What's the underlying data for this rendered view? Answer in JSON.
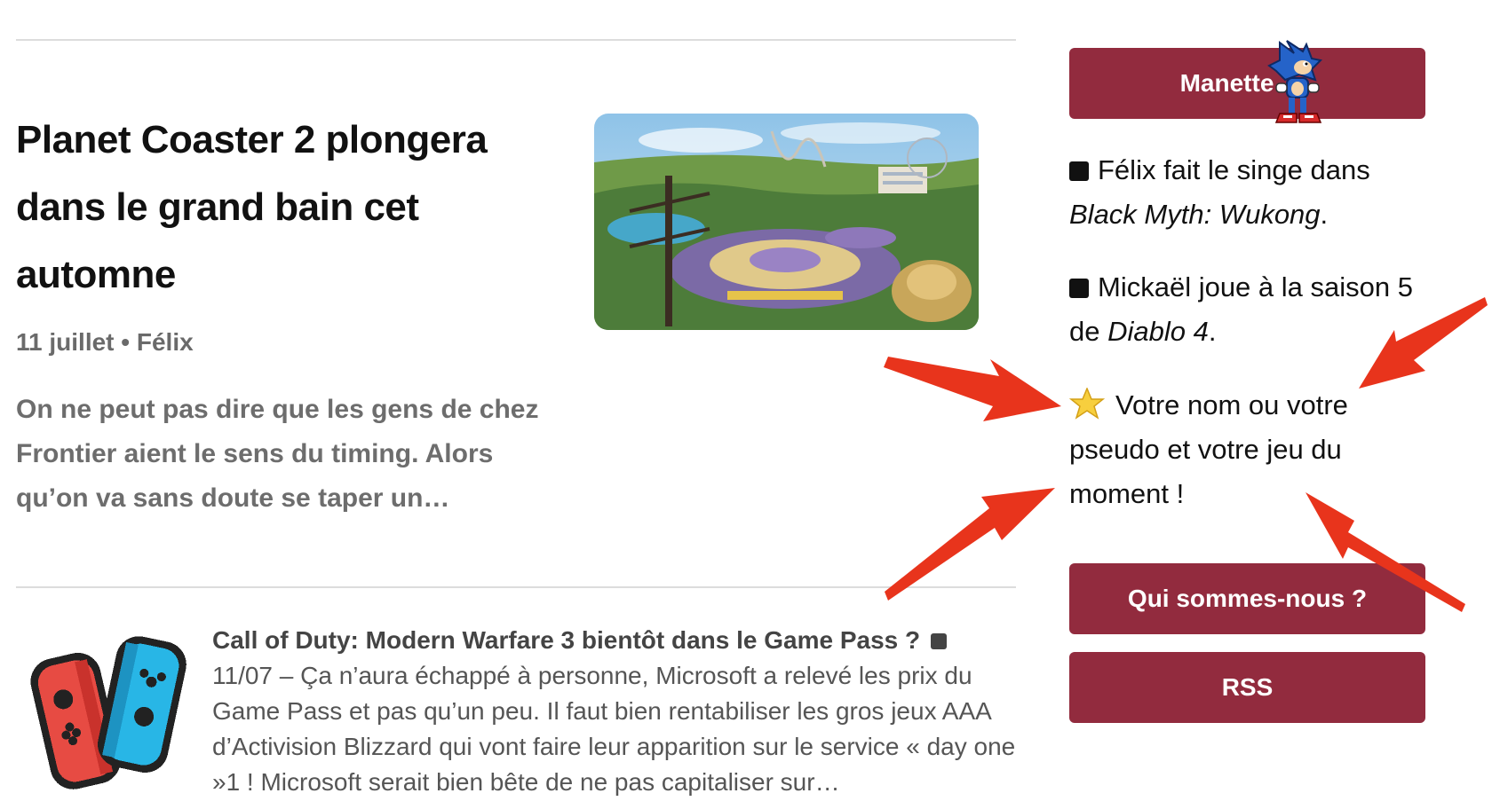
{
  "article": {
    "title": "Planet Coaster 2 plongera dans le grand bain cet automne",
    "meta": "11 juillet • Félix",
    "excerpt": "On ne peut pas dire que les gens de chez Frontier aient le sens du timing. Alors qu’on va sans doute se taper un…"
  },
  "short": {
    "title": "Call of Duty: Modern Warfare 3 bientôt dans le Game Pass ?",
    "body": "11/07 – Ça n’aura échappé à personne, Microsoft a relevé les prix du Game Pass et pas qu’un peu. Il faut bien rentabiliser les gros jeux AAA d’Activision Blizzard qui vont faire leur apparition sur le service « day one »1 ! Microsoft serait bien bête de ne pas capitaliser sur…"
  },
  "sidebar": {
    "manette_label": "Manette",
    "item1_prefix": "Félix fait le singe dans ",
    "item1_game": "Black Myth: Wukong",
    "item1_suffix": ".",
    "item2_prefix": "Mickaël joue à la saison 5 de ",
    "item2_game": "Diablo 4",
    "item2_suffix": ".",
    "item3_text": "Votre nom ou votre pseudo et votre jeu du moment !",
    "qui_label": "Qui sommes-nous ?",
    "rss_label": "RSS"
  },
  "colors": {
    "button_bg": "#922b3e",
    "arrow": "#e8341c",
    "divider": "#dcdcdc"
  },
  "icons": [
    "sonic-sprite-icon",
    "star-icon",
    "joycon-icon",
    "annotation-arrow"
  ]
}
